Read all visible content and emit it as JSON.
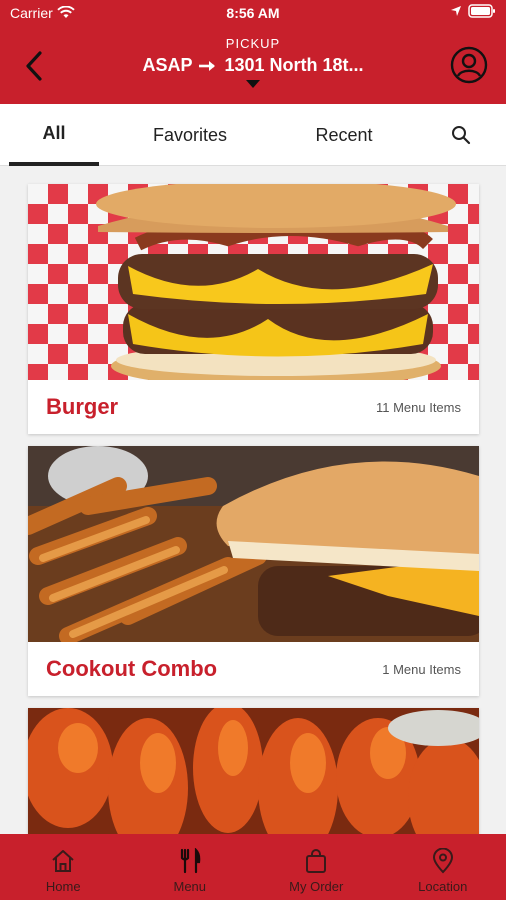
{
  "status_bar": {
    "carrier": "Carrier",
    "time": "8:56 AM"
  },
  "header": {
    "pickup_label": "PICKUP",
    "when": "ASAP",
    "location": "1301 North 18t..."
  },
  "tabs": [
    {
      "label": "All",
      "active": true
    },
    {
      "label": "Favorites"
    },
    {
      "label": "Recent"
    }
  ],
  "categories": [
    {
      "title": "Burger",
      "count": "11 Menu Items"
    },
    {
      "title": "Cookout Combo",
      "count": "1 Menu Items"
    }
  ],
  "bottom_nav": [
    {
      "label": "Home",
      "icon": "home-icon"
    },
    {
      "label": "Menu",
      "icon": "fork-knife-icon"
    },
    {
      "label": "My Order",
      "icon": "shopping-bag-icon"
    },
    {
      "label": "Location",
      "icon": "map-pin-icon"
    }
  ],
  "colors": {
    "brand": "#c8202c",
    "accent_text": "#c8202c"
  }
}
